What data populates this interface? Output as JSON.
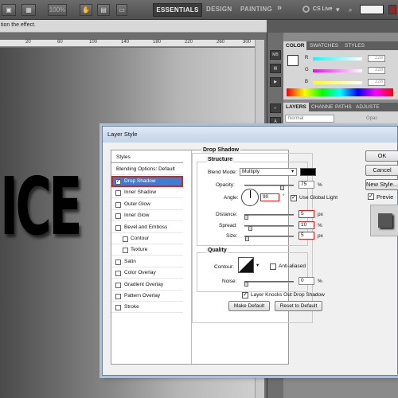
{
  "appbar": {
    "zoom": "100%",
    "workspaces": [
      "ESSENTIALS",
      "DESIGN",
      "PAINTING"
    ],
    "overflow": "»",
    "cs_live": "CS Live"
  },
  "options_bar": {
    "text": "tion the effect."
  },
  "ruler": {
    "ticks": [
      "20",
      "60",
      "100",
      "140",
      "180",
      "220",
      "260",
      "300"
    ]
  },
  "canvas": {
    "text": "ICE"
  },
  "color_panel": {
    "tabs": [
      "COLOR",
      "SWATCHES",
      "STYLES"
    ],
    "channels": [
      {
        "label": "R",
        "value": "228"
      },
      {
        "label": "G",
        "value": "228"
      },
      {
        "label": "B",
        "value": "228"
      }
    ]
  },
  "layers_panel": {
    "tabs": [
      "LAYERS",
      "CHANNE",
      "PATHS",
      "ADJUSTE"
    ],
    "blend_mode": "Normal",
    "opacity_label": "Opac"
  },
  "dialog": {
    "title": "Layer Style",
    "styles_header": "Styles",
    "blending_options": "Blending Options: Default",
    "effects": [
      {
        "label": "Drop Shadow",
        "checked": true
      },
      {
        "label": "Inner Shadow",
        "checked": false
      },
      {
        "label": "Outer Glow",
        "checked": false
      },
      {
        "label": "Inner Glow",
        "checked": false
      },
      {
        "label": "Bevel and Emboss",
        "checked": false
      },
      {
        "label": "Contour",
        "checked": false
      },
      {
        "label": "Texture",
        "checked": false
      },
      {
        "label": "Satin",
        "checked": false
      },
      {
        "label": "Color Overlay",
        "checked": false
      },
      {
        "label": "Gradient Overlay",
        "checked": false
      },
      {
        "label": "Pattern Overlay",
        "checked": false
      },
      {
        "label": "Stroke",
        "checked": false
      }
    ],
    "drop_shadow": {
      "section_title": "Drop Shadow",
      "structure_title": "Structure",
      "blend_mode_label": "Blend Mode:",
      "blend_mode_value": "Multiply",
      "shadow_color": "#000000",
      "opacity_label": "Opacity:",
      "opacity_value": "75",
      "opacity_unit": "%",
      "angle_label": "Angle:",
      "angle_value": "90",
      "angle_unit": "°",
      "use_global_light": "Use Global Light",
      "use_global_light_checked": true,
      "distance_label": "Distance:",
      "distance_value": "5",
      "distance_unit": "px",
      "spread_label": "Spread:",
      "spread_value": "10",
      "spread_unit": "%",
      "size_label": "Size:",
      "size_value": "5",
      "size_unit": "px",
      "quality_title": "Quality",
      "contour_label": "Contour:",
      "anti_aliased": "Anti-aliased",
      "noise_label": "Noise:",
      "noise_value": "0",
      "noise_unit": "%",
      "knockout": "Layer Knocks Out Drop Shadow",
      "knockout_checked": true,
      "make_default": "Make Default",
      "reset_default": "Reset to Default"
    },
    "buttons": {
      "ok": "OK",
      "cancel": "Cancel",
      "new_style": "New Style...",
      "preview": "Previe"
    }
  }
}
